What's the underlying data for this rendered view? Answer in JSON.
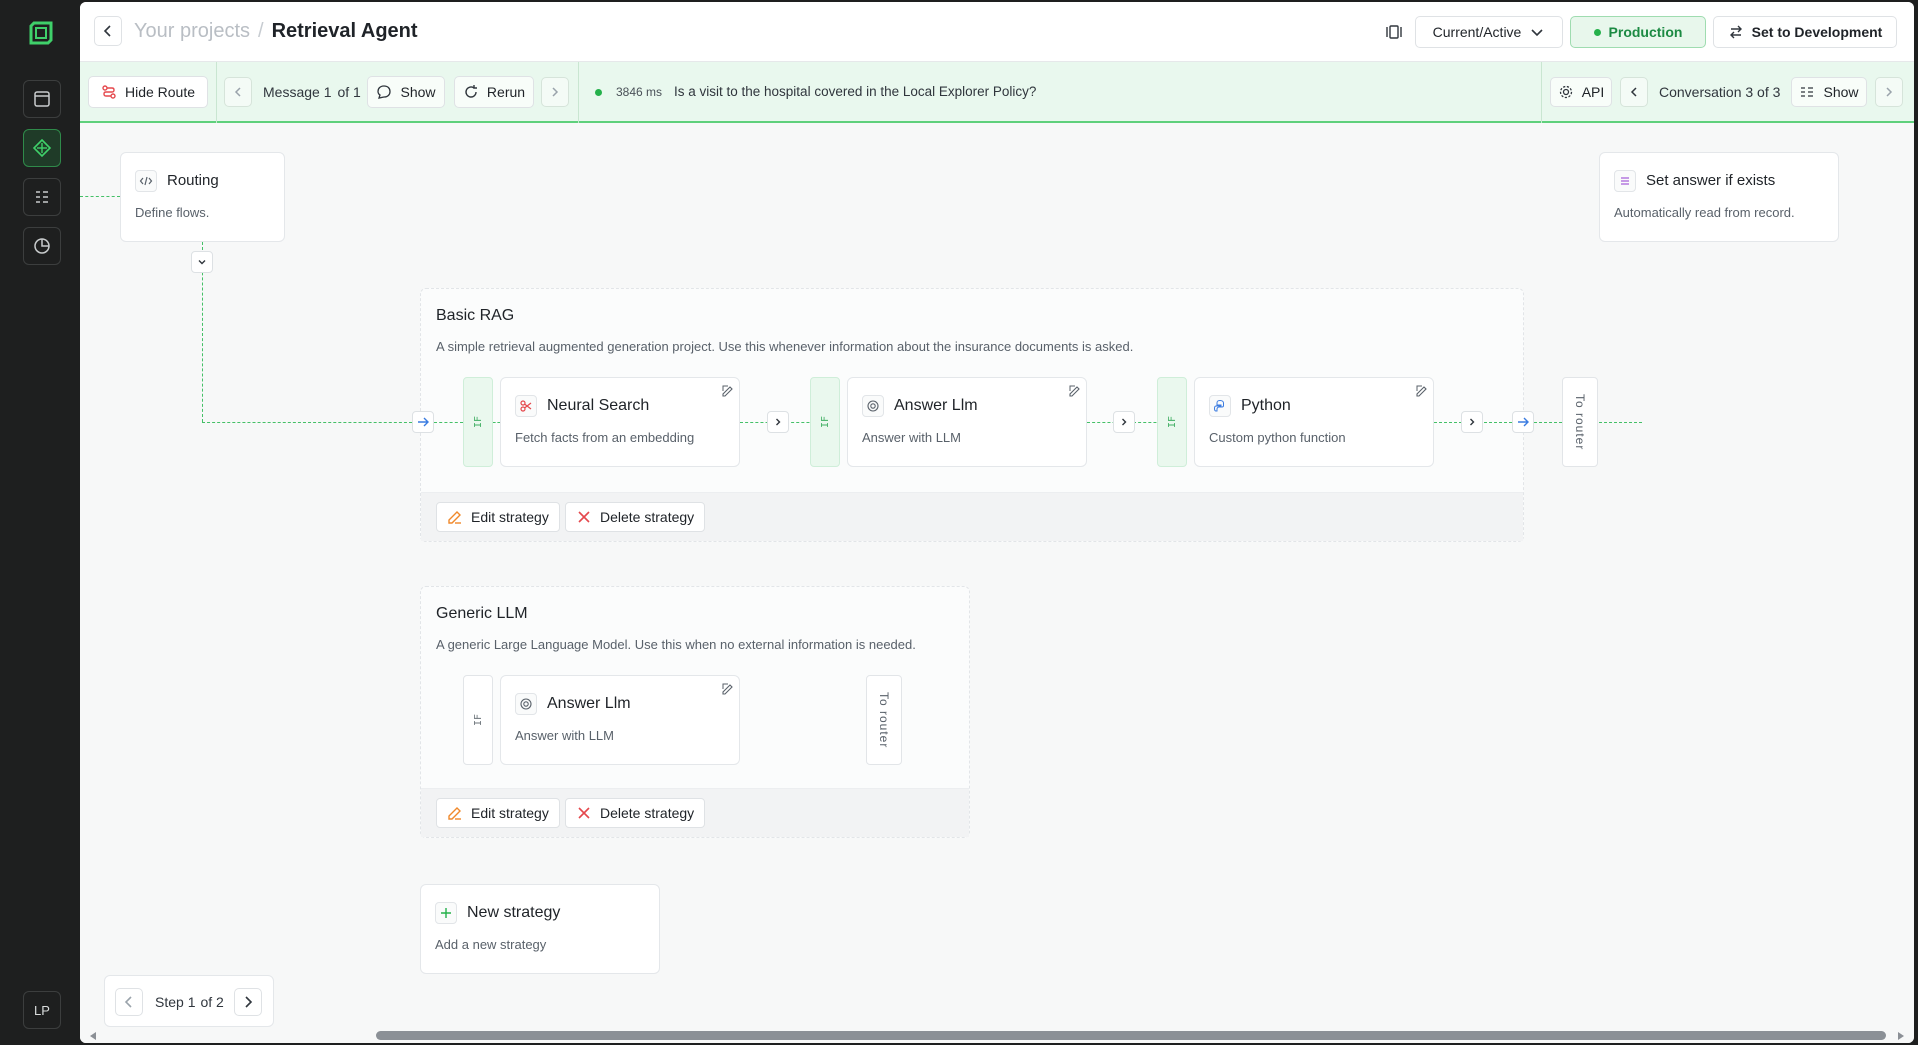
{
  "sidebar": {
    "avatar_initials": "LP",
    "items": [
      {
        "icon": "calendar-icon"
      },
      {
        "icon": "flow-icon",
        "active": true
      },
      {
        "icon": "list-icon"
      },
      {
        "icon": "pie-chart-icon"
      }
    ]
  },
  "header": {
    "breadcrumb_parent": "Your projects",
    "breadcrumb_sep": "/",
    "title": "Retrieval Agent",
    "version_select": "Current/Active",
    "production_label": "Production",
    "set_dev_label": "Set to Development"
  },
  "debugbar": {
    "hide_route_label": "Hide Route",
    "message_label": "Message 1",
    "message_of": "of 1",
    "show_label": "Show",
    "rerun_label": "Rerun",
    "latency": "3846 ms",
    "query": "Is a visit to the hospital covered in the Local Explorer Policy?",
    "api_label": "API",
    "conversation_label": "Conversation 3 of 3",
    "show2_label": "Show"
  },
  "canvas": {
    "routing": {
      "title": "Routing",
      "subtitle": "Define flows."
    },
    "set_answer": {
      "title": "Set answer if exists",
      "subtitle": "Automatically read from record."
    },
    "strategies": [
      {
        "title": "Basic RAG",
        "description": "A simple retrieval augmented generation project. Use this whenever information about the insurance documents is asked.",
        "nodes": [
          {
            "title": "Neural Search",
            "subtitle": "Fetch facts from an embedding"
          },
          {
            "title": "Answer Llm",
            "subtitle": "Answer with LLM"
          },
          {
            "title": "Python",
            "subtitle": "Custom python function"
          }
        ],
        "edit_label": "Edit strategy",
        "delete_label": "Delete strategy"
      },
      {
        "title": "Generic LLM",
        "description": "A generic Large Language Model. Use this when no external information is needed.",
        "nodes": [
          {
            "title": "Answer Llm",
            "subtitle": "Answer with LLM"
          }
        ],
        "edit_label": "Edit strategy",
        "delete_label": "Delete strategy"
      }
    ],
    "if_label": "IF",
    "to_router_label": "To router",
    "new_strategy": {
      "title": "New strategy",
      "subtitle": "Add a new strategy"
    },
    "stepper": {
      "label": "Step 1",
      "of": "of 2"
    }
  },
  "colors": {
    "accent": "#25b14b",
    "danger": "#e5484d",
    "edit": "#f0892b"
  }
}
